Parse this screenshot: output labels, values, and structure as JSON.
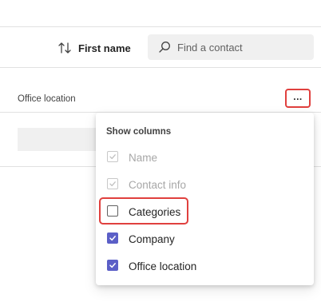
{
  "sort": {
    "label": "First name",
    "icon": "sort-arrows-icon"
  },
  "search": {
    "placeholder": "Find a contact",
    "value": "",
    "icon": "search-icon"
  },
  "table": {
    "column_header": "Office location"
  },
  "more_button": {
    "label": "...",
    "icon": "more-icon"
  },
  "menu": {
    "heading": "Show columns",
    "items": [
      {
        "label": "Name",
        "checked": true,
        "disabled": true
      },
      {
        "label": "Contact info",
        "checked": true,
        "disabled": true
      },
      {
        "label": "Categories",
        "checked": false,
        "disabled": false
      },
      {
        "label": "Company",
        "checked": true,
        "disabled": false
      },
      {
        "label": "Office location",
        "checked": true,
        "disabled": false
      }
    ]
  },
  "colors": {
    "accent": "#5b5fc7",
    "highlight": "#e0403e",
    "disabled_text": "#a7a7a7",
    "search_bg": "#f0f0f0"
  }
}
